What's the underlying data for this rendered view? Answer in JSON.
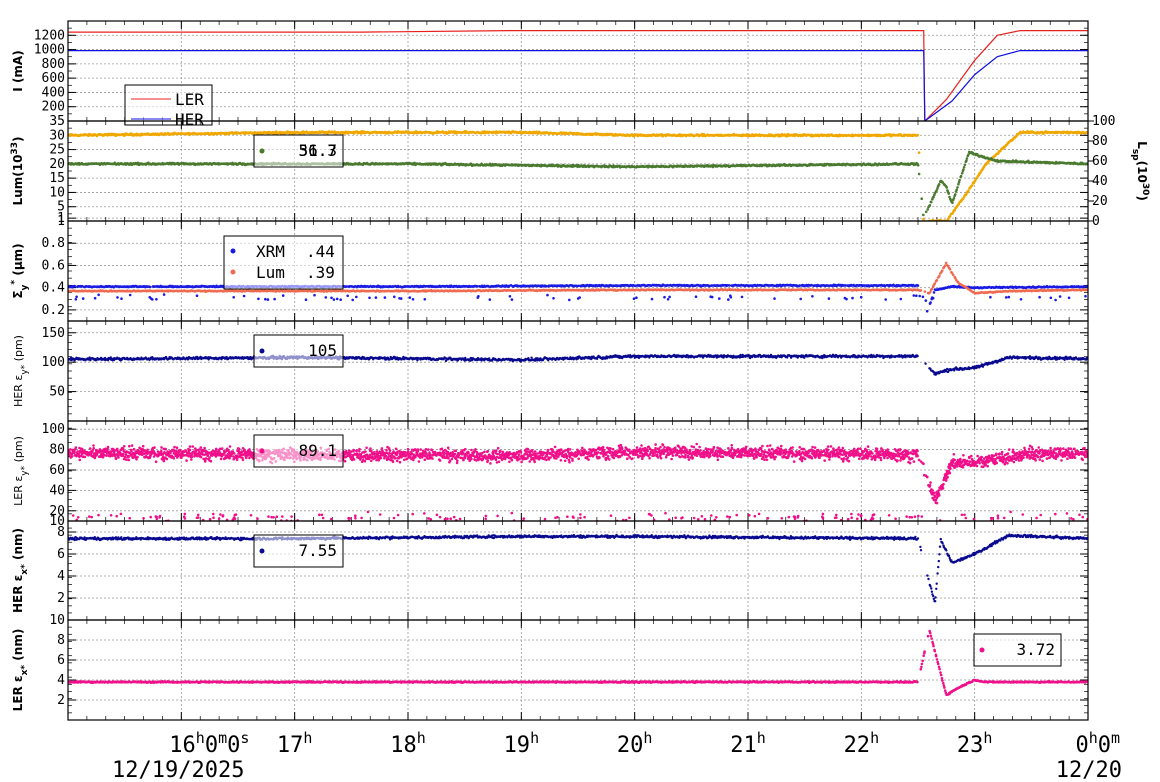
{
  "colors": {
    "ler_red": "#e8201c",
    "her_blue": "#1010e0",
    "lum_orange": "#f0a800",
    "lsp_green": "#4a7a30",
    "xrm_blue": "#1a1ae6",
    "lum_salmon": "#f06a50",
    "navy": "#0a0a90",
    "magenta": "#f0108a",
    "grid": "#999999"
  },
  "x_axis": {
    "tick_labels": [
      {
        "t": 16,
        "main": "16",
        "sup1": "h",
        "mid": "0",
        "sup2": "m",
        "tail": "0",
        "sup3": "s"
      },
      {
        "t": 17,
        "main": "17",
        "sup1": "h"
      },
      {
        "t": 18,
        "main": "18",
        "sup1": "h"
      },
      {
        "t": 19,
        "main": "19",
        "sup1": "h"
      },
      {
        "t": 20,
        "main": "20",
        "sup1": "h"
      },
      {
        "t": 21,
        "main": "21",
        "sup1": "h"
      },
      {
        "t": 22,
        "main": "22",
        "sup1": "h"
      },
      {
        "t": 23,
        "main": "23",
        "sup1": "h"
      },
      {
        "t": 24,
        "main": "0",
        "sup1": "h",
        "mid": "0",
        "sup2": "m"
      }
    ],
    "date_left": "12/19/2025",
    "date_right": "12/20",
    "range": [
      15.0,
      24.0
    ]
  },
  "panels": [
    {
      "id": "current",
      "ylabel": "I (mA)",
      "ylim": [
        0,
        1400
      ],
      "yticks": [
        "200",
        "400",
        "600",
        "800",
        "1000",
        "1200"
      ],
      "legend": [
        {
          "name": "LER",
          "value": ""
        },
        {
          "name": "HER",
          "value": ""
        }
      ]
    },
    {
      "id": "lum",
      "ylabel_main": "Lum(10",
      "ylabel_sup": "33",
      "ylabel_end": ")",
      "ylim": [
        0,
        35
      ],
      "yticks": [
        "1",
        "5",
        "10",
        "15",
        "20",
        "25",
        "30",
        "35"
      ],
      "y2label_main": "L",
      "y2label_sub": "sp",
      "y2label_mid": "(10",
      "y2label_sup": "30",
      "y2label_end": ")",
      "y2ticks": [
        "0",
        "20",
        "40",
        "60",
        "80",
        "100"
      ],
      "legend": [
        {
          "name": "",
          "value": "31.3"
        },
        {
          "name": "",
          "value": "56.7"
        }
      ]
    },
    {
      "id": "sigma",
      "ylabel_main": "Σ",
      "ylabel_sub": "y",
      "ylabel_sup": "*",
      "ylabel_end": " (μm)",
      "ylim": [
        0.1,
        1.0
      ],
      "yticks": [
        "0.2",
        "0.4",
        "0.6",
        "0.8",
        "1"
      ],
      "legend": [
        {
          "name": "XRM",
          "value": ".44"
        },
        {
          "name": "Lum",
          "value": ".39"
        }
      ]
    },
    {
      "id": "her_ey",
      "ylabel_main": "HER ε",
      "ylabel_sub": "y*",
      "ylabel_end": " (pm)",
      "ylim": [
        0,
        170
      ],
      "yticks": [
        "50",
        "100",
        "150"
      ],
      "legend": [
        {
          "name": "",
          "value": "105"
        }
      ]
    },
    {
      "id": "ler_ey",
      "ylabel_main": "LER ε",
      "ylabel_sub": "y*",
      "ylabel_end": " (pm)",
      "ylim": [
        10,
        108
      ],
      "yticks": [
        "10",
        "20",
        "40",
        "60",
        "80",
        "100"
      ],
      "legend": [
        {
          "name": "",
          "value": "89.1"
        }
      ]
    },
    {
      "id": "her_ex",
      "ylabel_main": "HER ε",
      "ylabel_sub": "x*",
      "ylabel_end": " (nm)",
      "ylim": [
        0,
        9
      ],
      "yticks": [
        "2",
        "4",
        "6",
        "8"
      ],
      "legend": [
        {
          "name": "",
          "value": "7.55"
        }
      ]
    },
    {
      "id": "ler_ex",
      "ylabel_main": "LER ε",
      "ylabel_sub": "x*",
      "ylabel_end": " (nm)",
      "ylim": [
        0,
        10
      ],
      "yticks": [
        "2",
        "4",
        "6",
        "8",
        "10"
      ],
      "legend": [
        {
          "name": "",
          "value": "3.72"
        }
      ]
    }
  ],
  "chart_data": {
    "type": "scatter",
    "x_unit": "hour of day (2025-12-19)",
    "xlim": [
      15.0,
      24.0
    ],
    "series": [
      {
        "panel": "current",
        "name": "LER",
        "x": [
          15.0,
          17.6,
          18.9,
          19.6,
          22.55,
          22.56,
          22.75,
          23.0,
          23.2,
          23.4,
          24.0
        ],
        "y": [
          1245,
          1245,
          1265,
          1265,
          1265,
          0,
          300,
          850,
          1200,
          1265,
          1265
        ]
      },
      {
        "panel": "current",
        "name": "HER",
        "x": [
          15.0,
          22.55,
          22.56,
          22.8,
          23.0,
          23.2,
          23.4,
          24.0
        ],
        "y": [
          985,
          985,
          0,
          280,
          650,
          900,
          985,
          985
        ]
      },
      {
        "panel": "lum",
        "name": "",
        "x": [
          15.0,
          17.0,
          19.0,
          20.0,
          22.5,
          22.55,
          22.75,
          22.9,
          23.1,
          23.4,
          24.0
        ],
        "y": [
          30,
          31,
          31,
          30,
          30,
          0,
          0,
          8,
          20,
          31,
          31
        ]
      },
      {
        "panel": "lum",
        "name": "",
        "x": [
          15.0,
          18.0,
          20.0,
          22.5,
          22.55,
          22.7,
          22.75,
          22.8,
          22.95,
          23.2,
          24.0
        ],
        "y": [
          20,
          20,
          19,
          20,
          1,
          14,
          12,
          6,
          24,
          21,
          20
        ]
      },
      {
        "panel": "sigma",
        "name": "XRM",
        "x": [
          15.0,
          18.0,
          20.0,
          22.5,
          22.55,
          22.65,
          22.8,
          23.0,
          24.0
        ],
        "y": [
          0.41,
          0.41,
          0.42,
          0.42,
          0.1,
          0.38,
          0.41,
          0.4,
          0.41
        ]
      },
      {
        "panel": "sigma",
        "name": "Lum",
        "x": [
          15.0,
          18.0,
          20.0,
          22.5,
          22.6,
          22.75,
          22.85,
          23.0,
          23.3,
          24.0
        ],
        "y": [
          0.37,
          0.37,
          0.38,
          0.38,
          0.35,
          0.62,
          0.45,
          0.35,
          0.37,
          0.38
        ]
      },
      {
        "panel": "her_ey",
        "name": "",
        "x": [
          15.0,
          17.0,
          19.0,
          20.0,
          22.5,
          22.65,
          22.8,
          23.0,
          23.3,
          24.0
        ],
        "y": [
          105,
          108,
          104,
          110,
          110,
          80,
          88,
          90,
          108,
          106
        ]
      },
      {
        "panel": "ler_ey",
        "name": "",
        "x": [
          15.0,
          17.0,
          19.0,
          20.0,
          22.5,
          22.65,
          22.8,
          23.0,
          23.5,
          24.0
        ],
        "y": [
          77,
          75,
          74,
          78,
          75,
          30,
          67,
          68,
          76,
          75
        ]
      },
      {
        "panel": "her_ex",
        "name": "",
        "x": [
          15.0,
          17.0,
          19.0,
          20.0,
          22.5,
          22.65,
          22.7,
          22.8,
          23.0,
          23.3,
          24.0
        ],
        "y": [
          7.4,
          7.4,
          7.6,
          7.6,
          7.4,
          1.5,
          7.3,
          5.2,
          6.0,
          7.7,
          7.4
        ]
      },
      {
        "panel": "ler_ex",
        "name": "",
        "x": [
          15.0,
          18.0,
          20.0,
          22.5,
          22.6,
          22.75,
          22.85,
          23.0,
          23.1,
          24.0
        ],
        "y": [
          3.8,
          3.8,
          3.8,
          3.8,
          9.0,
          2.5,
          3.2,
          4.0,
          3.8,
          3.8
        ]
      }
    ]
  }
}
